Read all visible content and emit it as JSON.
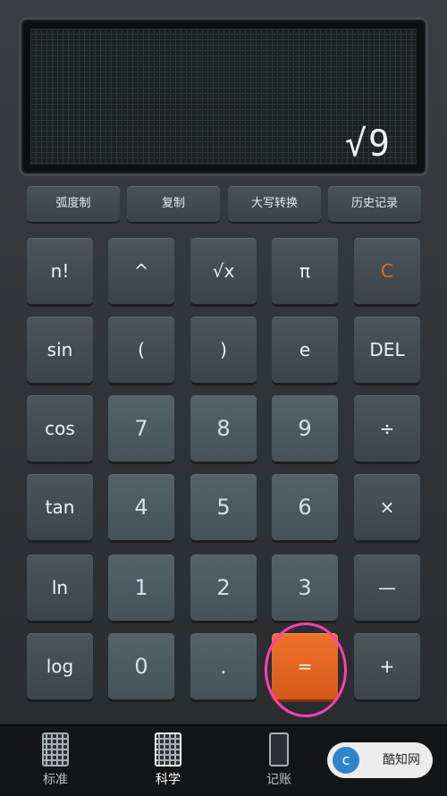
{
  "display": {
    "expression": "√9"
  },
  "function_row": [
    {
      "label": "弧度制"
    },
    {
      "label": "复制"
    },
    {
      "label": "大写转换"
    },
    {
      "label": "历史记录"
    }
  ],
  "keys": {
    "factorial": "n!",
    "power": "^",
    "root": "√x",
    "pi": "π",
    "clear": "C",
    "sin": "sin",
    "lparen": "(",
    "rparen": ")",
    "e": "e",
    "del": "DEL",
    "cos": "cos",
    "d7": "7",
    "d8": "8",
    "d9": "9",
    "div": "÷",
    "tan": "tan",
    "d4": "4",
    "d5": "5",
    "d6": "6",
    "mul": "×",
    "ln": "ln",
    "d1": "1",
    "d2": "2",
    "d3": "3",
    "sub": "—",
    "log": "log",
    "d0": "0",
    "dot": ".",
    "equals": "=",
    "add": "+"
  },
  "tabs": [
    {
      "label": "标准",
      "icon": "calculator-icon"
    },
    {
      "label": "科学",
      "icon": "calculator-icon",
      "active": true
    },
    {
      "label": "记账",
      "icon": "ledger-icon"
    }
  ],
  "watermark": {
    "text": "酷知网",
    "logo": "c"
  },
  "colors": {
    "accent": "#e06a2a",
    "highlight": "#ff3fb2",
    "equals_bg": "#e4621f"
  }
}
